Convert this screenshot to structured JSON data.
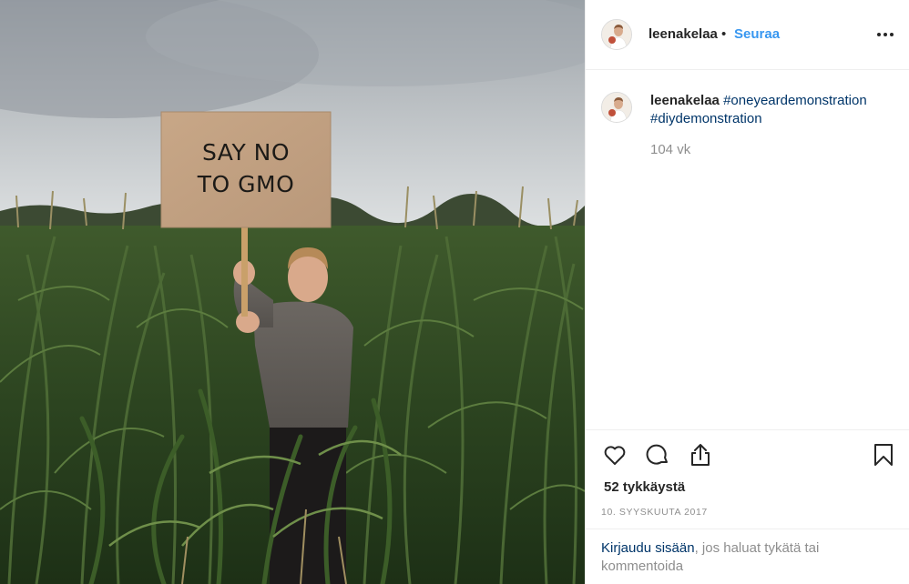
{
  "post": {
    "image_alt": "Woman in corn field holding a sign",
    "sign_text": "SAY NO\nTO GMO"
  },
  "header": {
    "username": "leenakelaa",
    "separator": "•",
    "follow_label": "Seuraa",
    "avatar_icon": "profile-avatar",
    "more_icon": "more-options-icon"
  },
  "caption": {
    "username": "leenakelaa",
    "hashtag_1": "#oneyeardemonstration",
    "hashtag_2": "#diydemonstration",
    "time_ago": "104 vk"
  },
  "actions": {
    "like_icon": "heart-icon",
    "comment_icon": "comment-icon",
    "share_icon": "share-icon",
    "save_icon": "bookmark-icon"
  },
  "likes_text": "52 tykkäystä",
  "date_text": "10. SYYSKUUTA 2017",
  "login": {
    "link_text": "Kirjaudu sisään",
    "rest_text": ", jos haluat tykätä tai kommentoida"
  },
  "colors": {
    "link_blue": "#3897f0",
    "hashtag_blue": "#003569",
    "muted_gray": "#8e8e8e",
    "text": "#262626"
  }
}
